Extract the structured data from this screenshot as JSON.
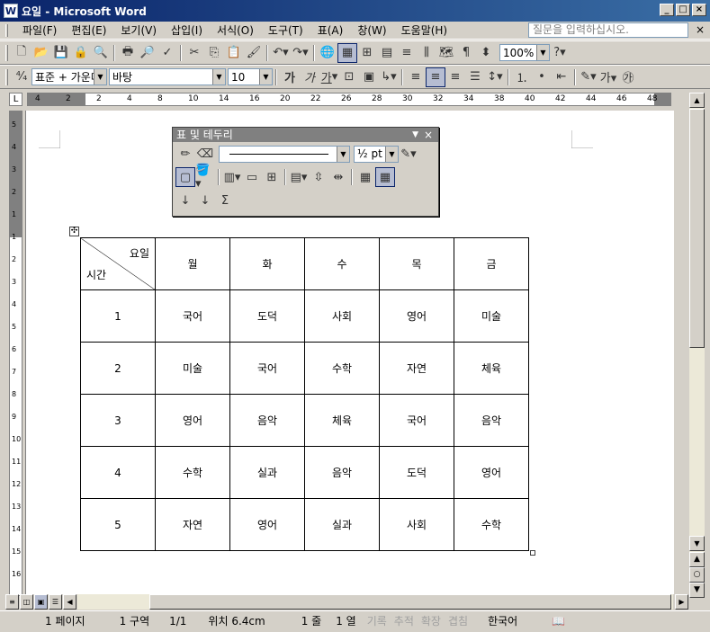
{
  "window": {
    "title": "요일 - Microsoft Word",
    "app_icon_label": "W"
  },
  "menubar": {
    "items": [
      "파일(F)",
      "편집(E)",
      "보기(V)",
      "삽입(I)",
      "서식(O)",
      "도구(T)",
      "표(A)",
      "창(W)",
      "도움말(H)"
    ],
    "ask_placeholder": "질문을 입력하십시오.",
    "close_glyph": "×"
  },
  "toolbar1": {
    "zoom": "100%"
  },
  "toolbar2": {
    "style": "표준 + 가운데",
    "font": "바탕",
    "size": "10"
  },
  "ruler": {
    "h_ticks": [
      "4",
      "2",
      "2",
      "4",
      "8",
      "10",
      "14",
      "16",
      "20",
      "22",
      "26",
      "28",
      "30",
      "32",
      "34",
      "38",
      "40",
      "42",
      "44",
      "46",
      "48"
    ],
    "v_ticks": [
      "5",
      "4",
      "3",
      "2",
      "1",
      "1",
      "2",
      "3",
      "4",
      "5",
      "6",
      "7",
      "8",
      "9",
      "10",
      "11",
      "12",
      "13",
      "14",
      "15",
      "16"
    ]
  },
  "floating_toolbar": {
    "title": "표 및 테두리",
    "line_weight": "½ pt"
  },
  "table": {
    "header_top": "요일",
    "header_bottom": "시간",
    "days": [
      "월",
      "화",
      "수",
      "목",
      "금"
    ],
    "rows": [
      {
        "period": "1",
        "cells": [
          "국어",
          "도덕",
          "사회",
          "영어",
          "미술"
        ]
      },
      {
        "period": "2",
        "cells": [
          "미술",
          "국어",
          "수학",
          "자연",
          "체육"
        ]
      },
      {
        "period": "3",
        "cells": [
          "영어",
          "음악",
          "체육",
          "국어",
          "음악"
        ]
      },
      {
        "period": "4",
        "cells": [
          "수학",
          "실과",
          "음악",
          "도덕",
          "영어"
        ]
      },
      {
        "period": "5",
        "cells": [
          "자연",
          "영어",
          "실과",
          "사회",
          "수학"
        ]
      }
    ]
  },
  "statusbar": {
    "page": "1 페이지",
    "section": "1 구역",
    "pages": "1/1",
    "position": "위치 6.4cm",
    "line": "1 줄",
    "column": "1 열",
    "rec": "기록",
    "trk": "추적",
    "ext": "확장",
    "ovr": "겹침",
    "language": "한국어"
  }
}
